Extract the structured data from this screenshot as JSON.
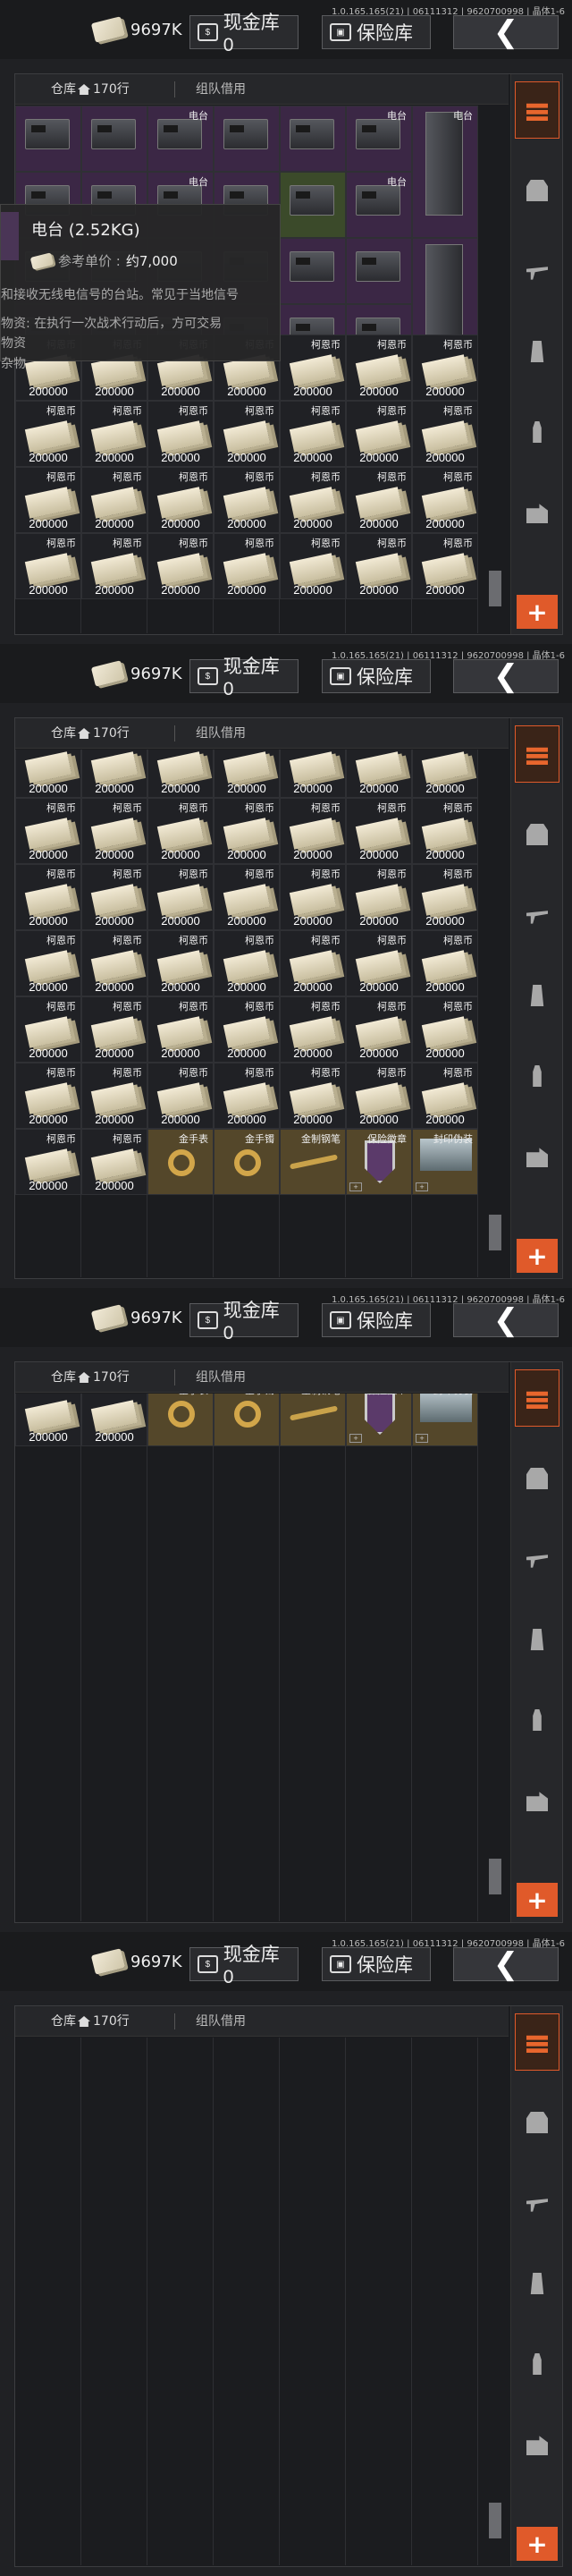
{
  "header": {
    "version": "1.0.165.165(21) | 06111312 | 9620700998 | 晶体1-6",
    "money": "9697K",
    "cash_vault": "现金库 0",
    "safe_vault": "保险库"
  },
  "tabs": {
    "warehouse": "仓库",
    "rows": "170行",
    "team_borrow": "组队借用"
  },
  "items": {
    "radio": "电台",
    "coin": "柯恩币",
    "coin_qty": "200000",
    "gold_watch": "金手表",
    "gold_ring": "金手镯",
    "gold_pen": "金制钢笔",
    "badge": "保险徽章",
    "doc": "封印伪装"
  },
  "tooltip": {
    "title": "电台 (2.52KG)",
    "price_label": "参考单价 :",
    "price_value": "约7,000",
    "desc": "和接收无线电信号的台站。常见于当地信号",
    "line2": "物资: 在执行一次战术行动后，方可交易",
    "line3": "物资",
    "line4": "杂物"
  },
  "sidebar": {
    "icons": [
      "stack-icon",
      "vest-icon",
      "rifle-icon",
      "magazine-icon",
      "ammo-icon",
      "box-icon"
    ],
    "accent": "#e05a2a"
  }
}
